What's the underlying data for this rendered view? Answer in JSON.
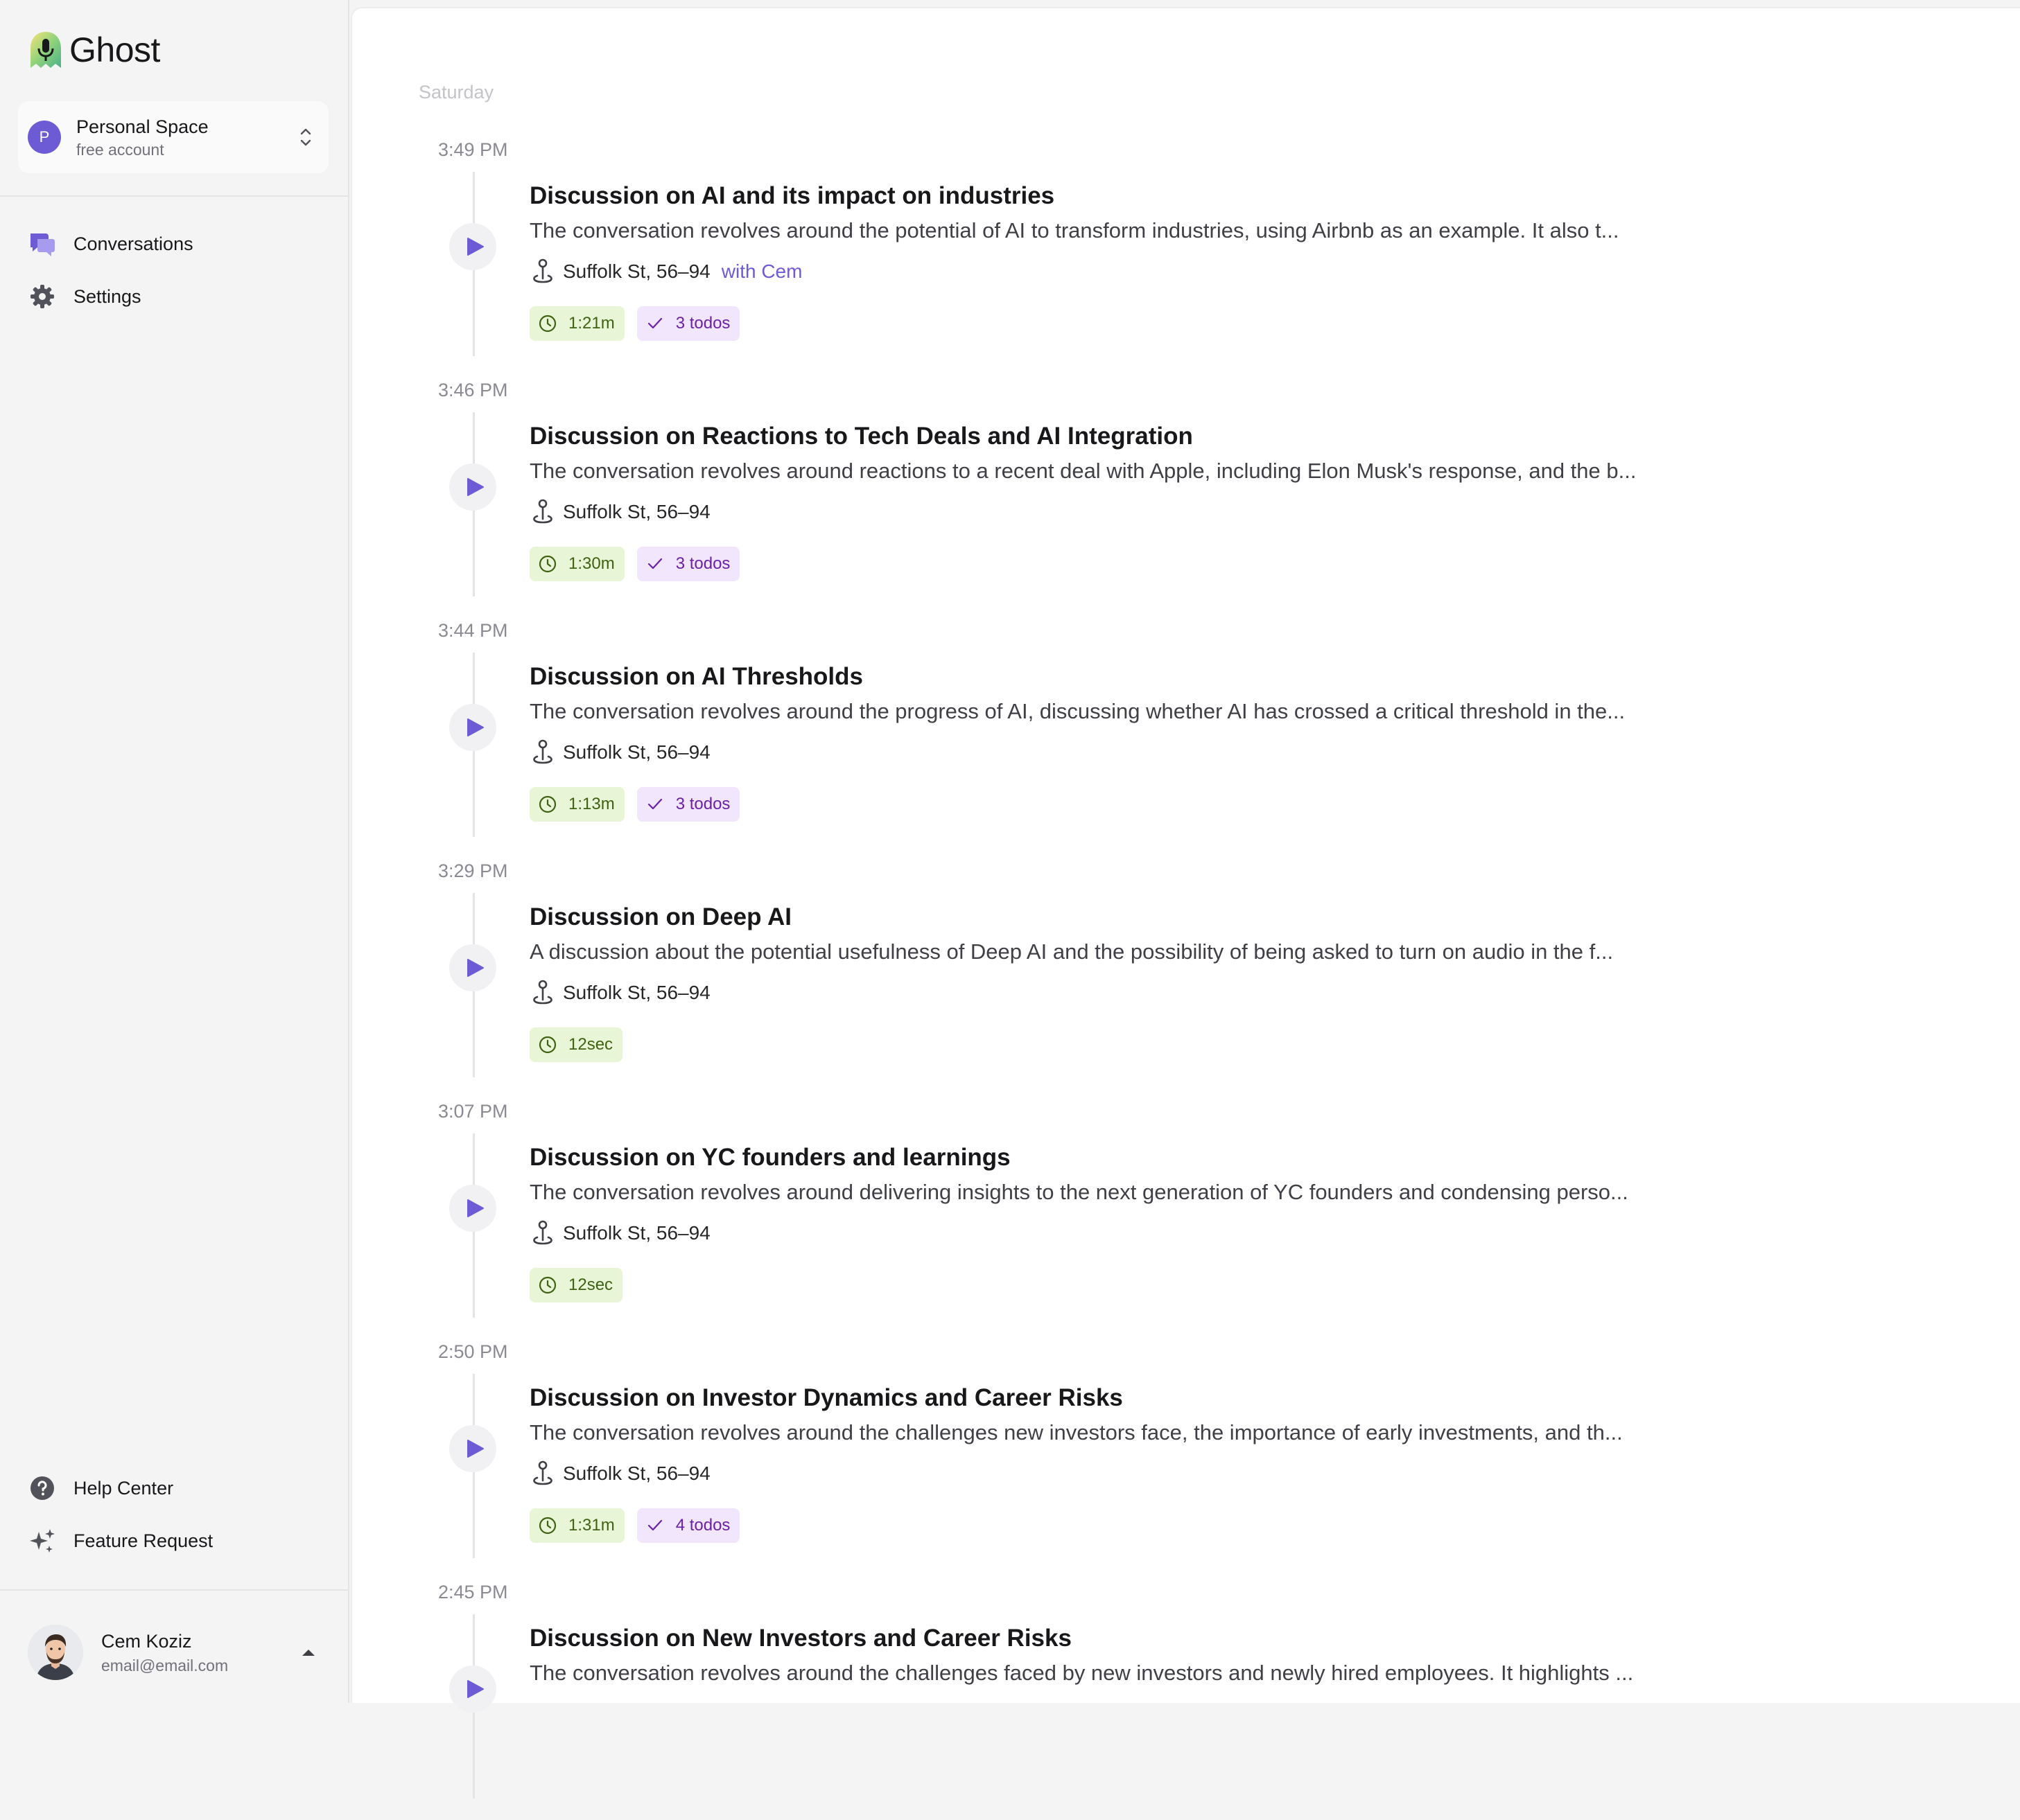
{
  "app": {
    "name": "Ghost"
  },
  "workspace": {
    "name": "Personal Space",
    "plan": "free account",
    "avatar_letter": "P"
  },
  "nav": {
    "conversations": "Conversations",
    "settings": "Settings"
  },
  "footer_nav": {
    "help": "Help Center",
    "feature": "Feature Request"
  },
  "user": {
    "name": "Cem Koziz",
    "email": "email@email.com"
  },
  "colors": {
    "accent": "#6d5bd6",
    "duration_bg": "#e8f5d6",
    "todos_bg": "#f1e6fb"
  },
  "feed": {
    "day": "Saturday",
    "entries": [
      {
        "time": "3:49 PM",
        "title": "Discussion on AI and its impact on industries",
        "summary": "The conversation revolves around the potential of AI to transform industries, using Airbnb as an example. It also t...",
        "location": "Suffolk St, 56–94",
        "with": "with Cem",
        "duration": "1:21m",
        "todos": "3 todos"
      },
      {
        "time": "3:46 PM",
        "title": "Discussion on Reactions to Tech Deals and AI Integration",
        "summary": "The conversation revolves around reactions to a recent deal with Apple, including Elon Musk's response, and the b...",
        "location": "Suffolk St, 56–94",
        "with": "",
        "duration": "1:30m",
        "todos": "3 todos"
      },
      {
        "time": "3:44 PM",
        "title": "Discussion on AI Thresholds",
        "summary": "The conversation revolves around the progress of AI, discussing whether AI has crossed a critical threshold in the...",
        "location": "Suffolk St, 56–94",
        "with": "",
        "duration": "1:13m",
        "todos": "3 todos"
      },
      {
        "time": "3:29 PM",
        "title": "Discussion on Deep AI",
        "summary": "A discussion about the potential usefulness of Deep AI and the possibility of being asked to turn on audio in the f...",
        "location": "Suffolk St, 56–94",
        "with": "",
        "duration": "12sec",
        "todos": ""
      },
      {
        "time": "3:07 PM",
        "title": "Discussion on YC founders and learnings",
        "summary": "The conversation revolves around delivering insights to the next generation of YC founders and condensing perso...",
        "location": "Suffolk St, 56–94",
        "with": "",
        "duration": "12sec",
        "todos": ""
      },
      {
        "time": "2:50 PM",
        "title": "Discussion on Investor Dynamics and Career Risks",
        "summary": "The conversation revolves around the challenges new investors face, the importance of early investments, and th...",
        "location": "Suffolk St, 56–94",
        "with": "",
        "duration": "1:31m",
        "todos": "4 todos"
      },
      {
        "time": "2:45 PM",
        "title": "Discussion on New Investors and Career Risks",
        "summary": "The conversation revolves around the challenges faced by new investors and newly hired employees. It highlights ...",
        "location": "",
        "with": "",
        "duration": "",
        "todos": ""
      }
    ]
  }
}
